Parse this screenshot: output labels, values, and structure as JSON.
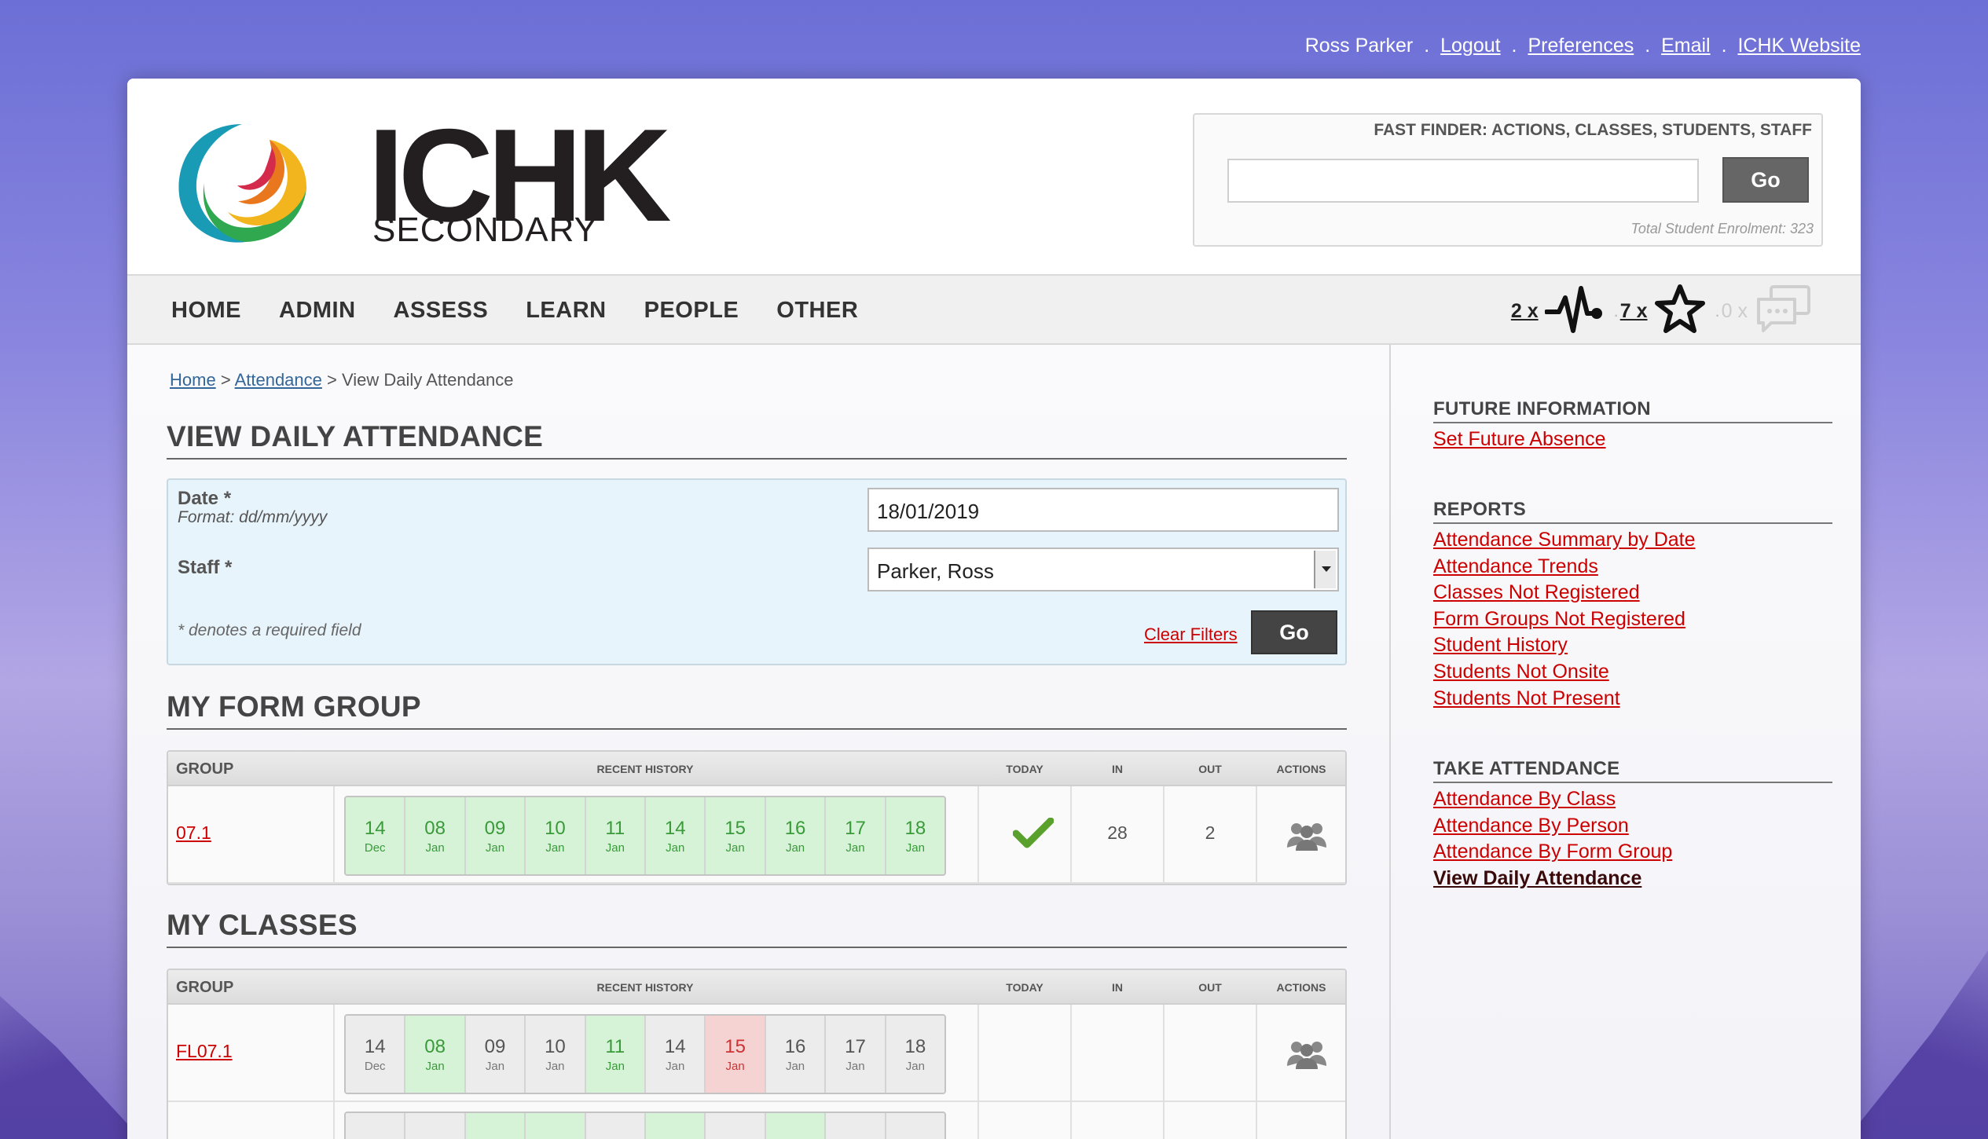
{
  "top_links": {
    "user": "Ross Parker",
    "logout": "Logout",
    "preferences": "Preferences",
    "email": "Email",
    "website": "ICHK Website",
    "separator": "."
  },
  "logo": {
    "main": "ICHK",
    "sub": "SECONDARY"
  },
  "fast_finder": {
    "title": "FAST FINDER: ACTIONS, CLASSES, STUDENTS, STAFF",
    "value": "",
    "button": "Go",
    "enrolment": "Total Student Enrolment: 323"
  },
  "nav": {
    "items": [
      "HOME",
      "ADMIN",
      "ASSESS",
      "LEARN",
      "PEOPLE",
      "OTHER"
    ]
  },
  "notifications": {
    "alerts": "2 x",
    "likes": "7 x",
    "messages": "0 x",
    "separator": "."
  },
  "breadcrumb": {
    "home": "Home",
    "attendance": "Attendance",
    "current": "View Daily Attendance",
    "sep": ">"
  },
  "page_title": "VIEW DAILY ATTENDANCE",
  "filter": {
    "date_label": "Date *",
    "date_format": "Format: dd/mm/yyyy",
    "date_value": "18/01/2019",
    "staff_label": "Staff *",
    "staff_value": "Parker, Ross",
    "required_note": "* denotes a required field",
    "clear": "Clear Filters",
    "go": "Go"
  },
  "form_group_section": {
    "title": "MY FORM GROUP",
    "headers": {
      "group": "GROUP",
      "history": "RECENT HISTORY",
      "today": "TODAY",
      "in": "IN",
      "out": "OUT",
      "actions": "ACTIONS"
    },
    "row": {
      "group": "07.1",
      "history": [
        {
          "d": "14",
          "m": "Dec",
          "s": "present"
        },
        {
          "d": "08",
          "m": "Jan",
          "s": "present"
        },
        {
          "d": "09",
          "m": "Jan",
          "s": "present"
        },
        {
          "d": "10",
          "m": "Jan",
          "s": "present"
        },
        {
          "d": "11",
          "m": "Jan",
          "s": "present"
        },
        {
          "d": "14",
          "m": "Jan",
          "s": "present"
        },
        {
          "d": "15",
          "m": "Jan",
          "s": "present"
        },
        {
          "d": "16",
          "m": "Jan",
          "s": "present"
        },
        {
          "d": "17",
          "m": "Jan",
          "s": "present"
        },
        {
          "d": "18",
          "m": "Jan",
          "s": "present"
        }
      ],
      "in": "28",
      "out": "2"
    }
  },
  "classes_section": {
    "title": "MY CLASSES",
    "headers": {
      "group": "GROUP",
      "history": "RECENT HISTORY",
      "today": "TODAY",
      "in": "IN",
      "out": "OUT",
      "actions": "ACTIONS"
    },
    "row": {
      "group": "FL07.1",
      "history": [
        {
          "d": "14",
          "m": "Dec",
          "s": "none"
        },
        {
          "d": "08",
          "m": "Jan",
          "s": "present"
        },
        {
          "d": "09",
          "m": "Jan",
          "s": "none"
        },
        {
          "d": "10",
          "m": "Jan",
          "s": "none"
        },
        {
          "d": "11",
          "m": "Jan",
          "s": "present"
        },
        {
          "d": "14",
          "m": "Jan",
          "s": "none"
        },
        {
          "d": "15",
          "m": "Jan",
          "s": "absent"
        },
        {
          "d": "16",
          "m": "Jan",
          "s": "none"
        },
        {
          "d": "17",
          "m": "Jan",
          "s": "none"
        },
        {
          "d": "18",
          "m": "Jan",
          "s": "none"
        }
      ]
    },
    "partial_row_history": [
      "none",
      "none",
      "present",
      "present",
      "none",
      "present",
      "none",
      "present",
      "none",
      "none"
    ]
  },
  "sidebar": {
    "future_title": "FUTURE INFORMATION",
    "future_links": [
      "Set Future Absence"
    ],
    "reports_title": "REPORTS",
    "reports_links": [
      "Attendance Summary by Date",
      "Attendance Trends",
      "Classes Not Registered",
      "Form Groups Not Registered",
      "Student History",
      "Students Not Onsite",
      "Students Not Present"
    ],
    "take_title": "TAKE ATTENDANCE",
    "take_links": [
      "Attendance By Class",
      "Attendance By Person",
      "Attendance By Form Group",
      "View Daily Attendance"
    ]
  },
  "colors": {
    "accent_link": "#cc0000",
    "present": "#d6f3d8",
    "absent": "#f6d3d3",
    "breadcrumb_link": "#336699"
  }
}
